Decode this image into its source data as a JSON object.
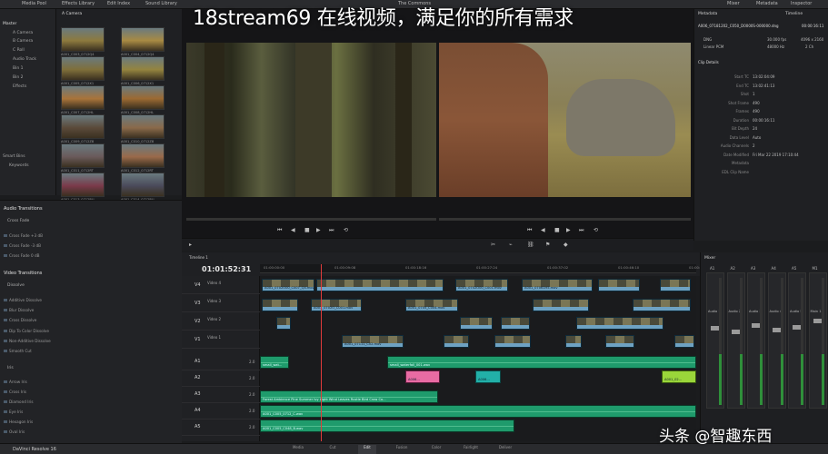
{
  "overlay_title": "18stream69 在线视频，满足你的所有需求",
  "watermark": "头条 @智趣东西",
  "app_name": "DaVinci Resolve 16",
  "topbar": {
    "media_pool": "Media Pool",
    "effects_library": "Effects Library",
    "edit_index": "Edit Index",
    "sound_library": "Sound Library",
    "center_title": "The Commons",
    "mixer": "Mixer",
    "metadata": "Metadata",
    "inspector": "Inspector"
  },
  "media_tree": {
    "header": "Master",
    "items": [
      "A Camera",
      "B Camera",
      "C Roll",
      "Audio Track",
      "Bin 1",
      "Bin 2",
      "Effects"
    ],
    "smart_bins": "Smart Bins",
    "keywords": "Keywords"
  },
  "media_grid": {
    "header": "A Camera",
    "labels": [
      "A001_C003_0712Q4",
      "A001_C004_0712Q4",
      "A001_C005_0712X1",
      "A001_C006_0712X1",
      "A001_C007_0712HL",
      "A001_C008_0712HL",
      "A001_C009_0712Z8",
      "A001_C010_0712Z8",
      "A001_C011_0712RT",
      "A001_C012_0712RT",
      "A001_C013_0712RU",
      "A001_C014_0712RU"
    ]
  },
  "effects": {
    "audio_transitions": "Audio Transitions",
    "cross_fade": "Cross Fade",
    "audio_items": [
      "Cross Fade +3 dB",
      "Cross Fade -3 dB",
      "Cross Fade 0 dB"
    ],
    "video_transitions": "Video Transitions",
    "dissolve": "Dissolve",
    "video_items": [
      "Additive Dissolve",
      "Blur Dissolve",
      "Cross Dissolve",
      "Dip To Color Dissolve",
      "Non-Additive Dissolve",
      "Smooth Cut"
    ],
    "iris": "Iris",
    "iris_items": [
      "Arrow Iris",
      "Cross Iris",
      "Diamond Iris",
      "Eye Iris",
      "Hexagon Iris",
      "Oval Iris"
    ]
  },
  "metadata_panel": {
    "tab_metadata": "Metadata",
    "tab_timeline": "Timeline",
    "clip_name": "A006_07181202_C050_D0000S-000000.dng",
    "clip_tc": "00:00:16:11",
    "dng_label": "DNG",
    "dng_fps": "30.000 fps",
    "dng_res": "4096 x 2160",
    "pcm_label": "Linear PCM",
    "pcm_rate": "48000 Hz",
    "pcm_ch": "2 Ch",
    "clip_details": "Clip Details",
    "rows": [
      {
        "k": "Start TC",
        "v": "13:02:04:09"
      },
      {
        "k": "End TC",
        "v": "13:02:41:13"
      },
      {
        "k": "Shot",
        "v": "1"
      },
      {
        "k": "Shot Frame",
        "v": "490"
      },
      {
        "k": "Frames",
        "v": "490"
      },
      {
        "k": "Duration",
        "v": "00:00:16:11"
      },
      {
        "k": "Bit Depth",
        "v": "24"
      },
      {
        "k": "Data Level",
        "v": "Auto"
      },
      {
        "k": "Audio Channels",
        "v": "2"
      },
      {
        "k": "Date Modified",
        "v": "Fri Mar 22 2019 17:10:44"
      },
      {
        "k": "Metadata",
        "v": ""
      },
      {
        "k": "EDL Clip Name",
        "v": ""
      }
    ]
  },
  "timeline": {
    "name": "Timeline 1",
    "timecode": "01:01:52:31",
    "ruler": [
      "01:00:00:00",
      "01:00:09:08",
      "01:00:18:16",
      "01:00:27:24",
      "01:00:37:02",
      "01:00:46:10",
      "01:00:55:18"
    ],
    "tracks": [
      {
        "id": "V4",
        "name": "Video 4"
      },
      {
        "id": "V3",
        "name": "Video 3"
      },
      {
        "id": "V2",
        "name": "Video 2"
      },
      {
        "id": "V1",
        "name": "Video 1"
      },
      {
        "id": "A1",
        "name": "2.0"
      },
      {
        "id": "A2",
        "name": "2.0"
      },
      {
        "id": "A3",
        "name": "2.0"
      },
      {
        "id": "A4",
        "name": "2.0"
      },
      {
        "id": "A5",
        "name": "2.0"
      }
    ],
    "clips": {
      "v4a": "A001_0702O00_C007_Q4.mov",
      "v4b": "A001_0702O00_C001.mov",
      "v4c": "A001_07061H5.mov",
      "v3a": "A001_0702O_C001.mov",
      "v3b": "A001_0705_C004.mov",
      "v1a": "A001_07111_C02.mov",
      "a1a": "small_waterfall_001.wav",
      "a1b": "small_wat...",
      "a3": "Forest Ambience Pine Summer Ivy Light Wind Leaves Rustle Bird Crow Co...",
      "a4": "A001_C005_0712_C.wav",
      "a5": "A001_C005_C048_B.wav",
      "pink": "A006...",
      "teal": "A006...",
      "lime": "A001_02..."
    }
  },
  "mixer": {
    "title": "Mixer",
    "channels": [
      "A1",
      "A2",
      "A3",
      "A4",
      "A5",
      "M1"
    ],
    "channel_names": [
      "Audio 1",
      "Audio 2",
      "Audio 3",
      "Audio 4",
      "Audio 5",
      "Main 1"
    ]
  },
  "pages": [
    "Media",
    "Cut",
    "Edit",
    "Fusion",
    "Color",
    "Fairlight",
    "Deliver"
  ]
}
